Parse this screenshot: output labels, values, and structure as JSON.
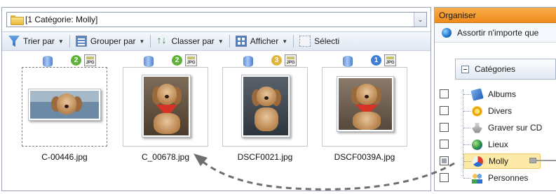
{
  "path_bar": {
    "text": "[1 Catégorie: Molly]",
    "dropdown_glyph": "⌄"
  },
  "toolbar": {
    "items": [
      {
        "label": "Trier par",
        "icon": "filter-icon"
      },
      {
        "label": "Grouper par",
        "icon": "group-icon"
      },
      {
        "label": "Classer par",
        "icon": "sort-arrows-icon"
      },
      {
        "label": "Afficher",
        "icon": "view-icon"
      },
      {
        "label": "Sélecti",
        "icon": "select-icon"
      }
    ],
    "caret": "▼"
  },
  "thumbnails": [
    {
      "filename": "C-00446.jpg",
      "rating": "2",
      "rating_color": "#5fb13a",
      "file_badge": "JPG",
      "selected": true
    },
    {
      "filename": "C_00678.jpg",
      "rating": "2",
      "rating_color": "#5fb13a",
      "file_badge": "JPG",
      "selected": false
    },
    {
      "filename": "DSCF0021.jpg",
      "rating": "3",
      "rating_color": "#e0b53a",
      "file_badge": "JPG",
      "selected": false
    },
    {
      "filename": "DSCF0039A.jpg",
      "rating": "1",
      "rating_color": "#3d7fd6",
      "file_badge": "JPG",
      "selected": false
    }
  ],
  "organizer": {
    "header": "Organiser",
    "assort": "Assortir n'importe que",
    "categories_label": "Catégories",
    "categories": [
      {
        "label": "Albums",
        "icon": "albums-icon",
        "checked": false
      },
      {
        "label": "Divers",
        "icon": "divers-icon",
        "checked": false
      },
      {
        "label": "Graver sur CD",
        "icon": "burn-cd-icon",
        "checked": false
      },
      {
        "label": "Lieux",
        "icon": "globe-icon",
        "checked": false
      },
      {
        "label": "Molly",
        "icon": "molly-category-icon",
        "checked": "partial",
        "active": true
      },
      {
        "label": "Personnes",
        "icon": "people-icon",
        "checked": false
      }
    ]
  },
  "colors": {
    "accent_orange": "#f08a1c",
    "toolbar_blue": "#dfe7f3",
    "highlight": "#fde9a8"
  }
}
